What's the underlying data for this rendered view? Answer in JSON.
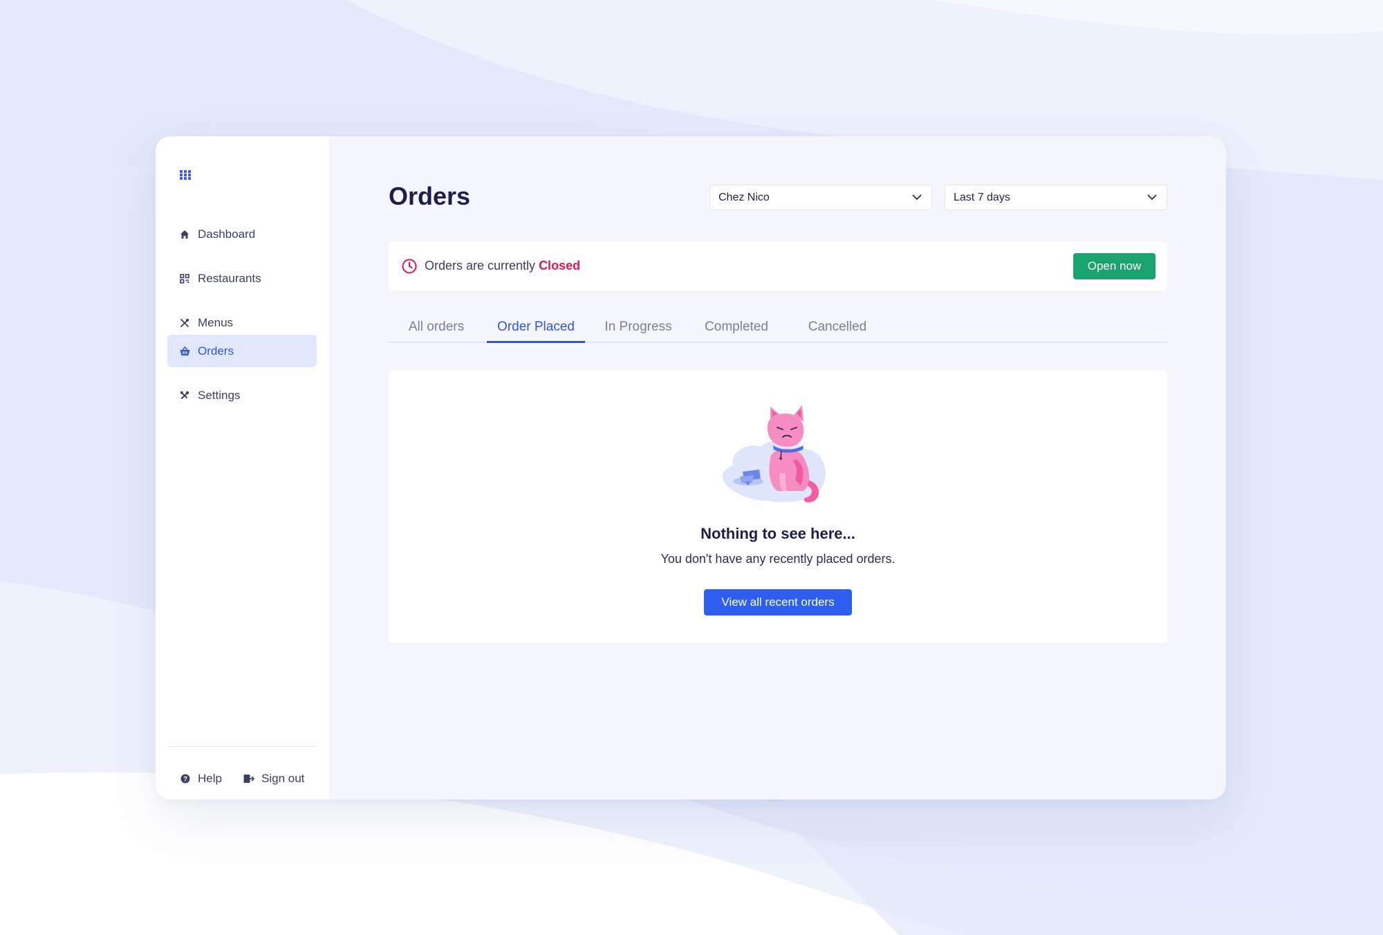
{
  "sidebar": {
    "logo_icon": "grid-icon",
    "items": [
      {
        "label": "Dashboard",
        "icon": "home-icon"
      },
      {
        "label": "Restaurants",
        "icon": "qr-code-icon"
      },
      {
        "label": "Menus",
        "icon": "utensils-icon"
      },
      {
        "label": "Orders",
        "icon": "basket-icon",
        "active": true
      },
      {
        "label": "Settings",
        "icon": "tools-icon"
      }
    ],
    "footer": {
      "help_label": "Help",
      "signout_label": "Sign out"
    }
  },
  "header": {
    "title": "Orders",
    "restaurant_select": {
      "value": "Chez Nico"
    },
    "period_select": {
      "value": "Last 7 days"
    }
  },
  "status": {
    "text": "Orders are currently",
    "state": "Closed",
    "action_label": "Open now"
  },
  "tabs": [
    {
      "label": "All orders"
    },
    {
      "label": "Order Placed",
      "active": true
    },
    {
      "label": "In Progress"
    },
    {
      "label": "Completed"
    },
    {
      "label": "Cancelled"
    }
  ],
  "empty_state": {
    "title": "Nothing to see here...",
    "subtitle": "You don't have any recently placed orders.",
    "button_label": "View all recent orders"
  },
  "colors": {
    "accent": "#2f56e0",
    "success": "#1aa36f",
    "danger": "#e3164a",
    "heading": "#1c1f4d"
  }
}
